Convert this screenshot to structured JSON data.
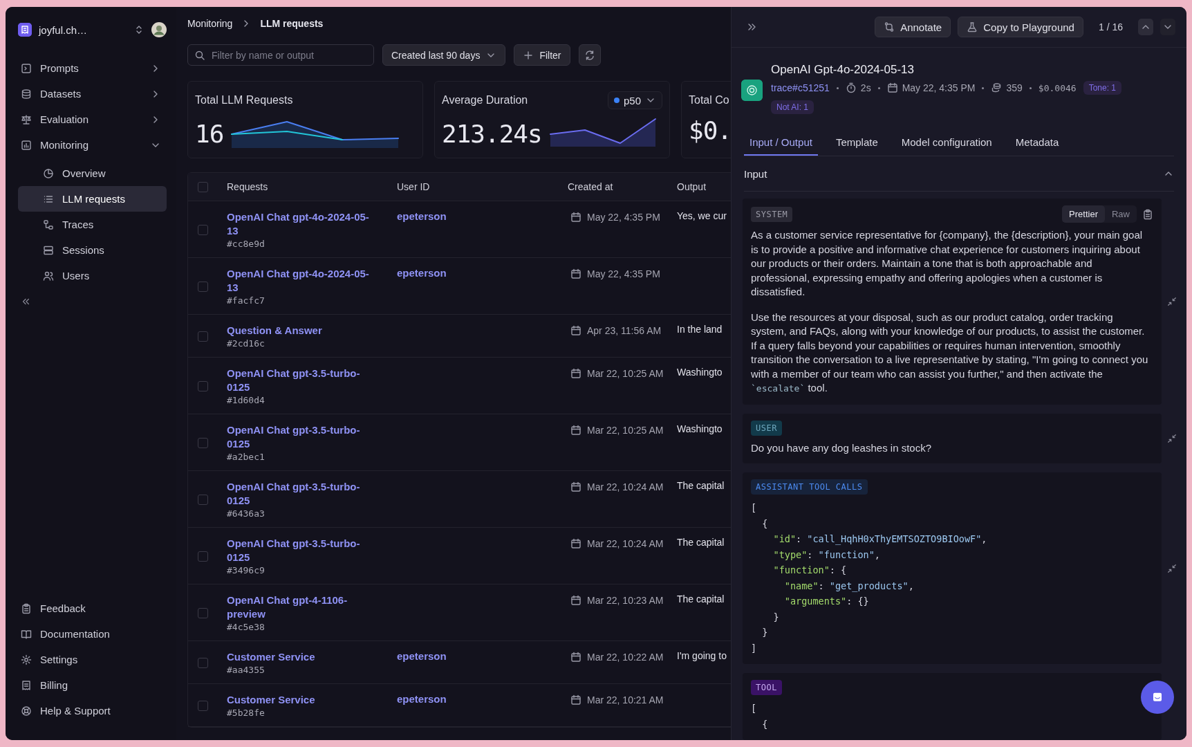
{
  "workspace": {
    "name": "joyful.ch…"
  },
  "sidebar": {
    "items": [
      {
        "label": "Prompts",
        "expanded": false
      },
      {
        "label": "Datasets",
        "expanded": false
      },
      {
        "label": "Evaluation",
        "expanded": false
      },
      {
        "label": "Monitoring",
        "expanded": true,
        "children": [
          {
            "label": "Overview",
            "selected": false
          },
          {
            "label": "LLM requests",
            "selected": true
          },
          {
            "label": "Traces",
            "selected": false
          },
          {
            "label": "Sessions",
            "selected": false
          },
          {
            "label": "Users",
            "selected": false
          }
        ]
      }
    ],
    "footer_items": [
      {
        "label": "Feedback"
      },
      {
        "label": "Documentation"
      },
      {
        "label": "Settings"
      },
      {
        "label": "Billing"
      },
      {
        "label": "Help & Support"
      }
    ]
  },
  "breadcrumb": [
    "Monitoring",
    "LLM requests"
  ],
  "toolbar": {
    "search": {
      "placeholder": "Filter by name or output"
    },
    "date_range": "Created last 90 days",
    "filter_button": "Filter"
  },
  "stats": [
    {
      "title": "Total LLM Requests",
      "value": "16"
    },
    {
      "title": "Average Duration",
      "value": "213.24s",
      "percentile": "p50"
    },
    {
      "title": "Total Co",
      "value": "$0."
    }
  ],
  "table": {
    "select_all": {
      "checked": false
    },
    "columns": [
      "Requests",
      "User ID",
      "Created at",
      "Output"
    ],
    "rows": [
      {
        "name": "OpenAI Chat gpt-4o-2024-05-13",
        "id": "#cc8e9d",
        "user": "epeterson",
        "created": "May 22, 4:35 PM",
        "output": "Yes, we cur",
        "checked": false
      },
      {
        "name": "OpenAI Chat gpt-4o-2024-05-13",
        "id": "#facfc7",
        "user": "epeterson",
        "created": "May 22, 4:35 PM",
        "checked": false
      },
      {
        "name": "Question & Answer",
        "id": "#2cd16c",
        "created": "Apr 23, 11:56 AM",
        "output": "In the land",
        "checked": false
      },
      {
        "name": "OpenAI Chat gpt-3.5-turbo-0125",
        "id": "#1d60d4",
        "created": "Mar 22, 10:25 AM",
        "output": "Washingto",
        "checked": false
      },
      {
        "name": "OpenAI Chat gpt-3.5-turbo-0125",
        "id": "#a2bec1",
        "created": "Mar 22, 10:25 AM",
        "output": "Washingto",
        "checked": false
      },
      {
        "name": "OpenAI Chat gpt-3.5-turbo-0125",
        "id": "#6436a3",
        "created": "Mar 22, 10:24 AM",
        "output": "The capital",
        "checked": false
      },
      {
        "name": "OpenAI Chat gpt-3.5-turbo-0125",
        "id": "#3496c9",
        "created": "Mar 22, 10:24 AM",
        "output": "The capital",
        "checked": false
      },
      {
        "name": "OpenAI Chat gpt-4-1106-preview",
        "id": "#4c5e38",
        "created": "Mar 22, 10:23 AM",
        "output": "The capital",
        "checked": false
      },
      {
        "name": "Customer Service",
        "id": "#aa4355",
        "user": "epeterson",
        "created": "Mar 22, 10:22 AM",
        "output": "I'm going to",
        "checked": false
      },
      {
        "name": "Customer Service",
        "id": "#5b28fe",
        "user": "epeterson",
        "created": "Mar 22, 10:21 AM",
        "checked": false
      }
    ]
  },
  "detail": {
    "buttons": [
      "Annotate",
      "Copy to Playground"
    ],
    "pager": "1 / 16",
    "title": "OpenAI Gpt-4o-2024-05-13",
    "trace": "trace#c51251",
    "duration": "2s",
    "date": "May 22, 4:35 PM",
    "tokens": "359",
    "cost": "$0.0046",
    "tags": [
      "Tone: 1",
      "Not AI: 1"
    ],
    "tabs": [
      {
        "label": "Input / Output",
        "selected": true
      },
      {
        "label": "Template",
        "selected": false
      },
      {
        "label": "Model configuration",
        "selected": false
      },
      {
        "label": "Metadata",
        "selected": false
      }
    ],
    "section": {
      "title": "Input",
      "expanded": true
    },
    "messages": [
      {
        "role": "SYSTEM",
        "kind": "system",
        "view_modes": [
          {
            "label": "Prettier",
            "selected": true
          },
          {
            "label": "Raw",
            "selected": false
          }
        ],
        "paragraphs": [
          {
            "text": "As a customer service representative for {company}, the {description}, your main goal is to provide a positive and informative chat experience for customers inquiring about our products or their orders. Maintain a tone that is both approachable and professional, expressing empathy and offering apologies when a customer is dissatisfied."
          },
          {
            "text": "Use the resources at your disposal, such as our product catalog, order tracking system, and FAQs, along with your knowledge of our products, to assist the customer. If a query falls beyond your capabilities or requires human intervention, smoothly transition the conversation to a live representative by stating, \"I'm going to connect you with a member of our team who can assist you further,\" and then activate the ",
            "code": "`escalate`",
            "after": " tool."
          }
        ]
      },
      {
        "role": "USER",
        "kind": "user",
        "paragraphs": [
          {
            "text": "Do you have any dog leashes in stock?"
          }
        ]
      },
      {
        "role": "ASSISTANT TOOL CALLS",
        "kind": "assistant",
        "code_lines": [
          "[",
          "  {",
          "    \"id\": \"call_HqhH0xThyEMTSOZTO9BIOowF\",",
          "    \"type\": \"function\",",
          "    \"function\": {",
          "      \"name\": \"get_products\",",
          "      \"arguments\": {}",
          "    }",
          "  }",
          "]"
        ]
      },
      {
        "role": "TOOL",
        "kind": "tool",
        "code_lines": [
          "[",
          "  {"
        ]
      }
    ]
  }
}
